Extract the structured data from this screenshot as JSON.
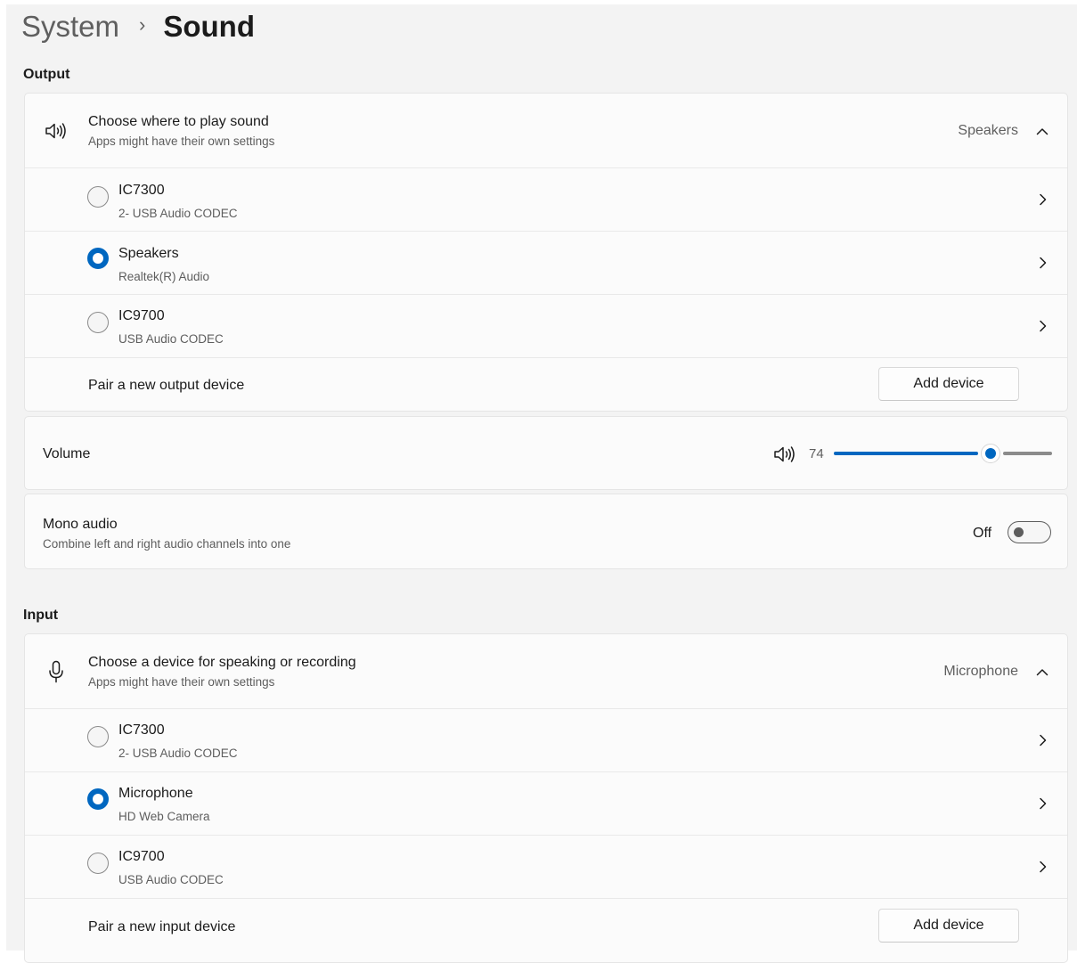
{
  "breadcrumb": {
    "parent": "System",
    "separator": "›",
    "current": "Sound"
  },
  "output": {
    "section_title": "Output",
    "chooser": {
      "title": "Choose where to play sound",
      "subtitle": "Apps might have their own settings",
      "selected_value": "Speakers"
    },
    "devices": [
      {
        "name": "IC7300",
        "detail": "2- USB Audio CODEC",
        "selected": false
      },
      {
        "name": "Speakers",
        "detail": "Realtek(R) Audio",
        "selected": true
      },
      {
        "name": "IC9700",
        "detail": "USB Audio CODEC",
        "selected": false
      }
    ],
    "pair": {
      "label": "Pair a new output device",
      "button": "Add device"
    },
    "volume": {
      "label": "Volume",
      "value": 74,
      "value_text": "74"
    },
    "mono": {
      "title": "Mono audio",
      "subtitle": "Combine left and right audio channels into one",
      "state_text": "Off",
      "enabled": false
    }
  },
  "input": {
    "section_title": "Input",
    "chooser": {
      "title": "Choose a device for speaking or recording",
      "subtitle": "Apps might have their own settings",
      "selected_value": "Microphone"
    },
    "devices": [
      {
        "name": "IC7300",
        "detail": "2- USB Audio CODEC",
        "selected": false
      },
      {
        "name": "Microphone",
        "detail": "HD Web Camera",
        "selected": true
      },
      {
        "name": "IC9700",
        "detail": "USB Audio CODEC",
        "selected": false
      }
    ],
    "pair": {
      "label": "Pair a new input device",
      "button": "Add device"
    }
  },
  "icons": {
    "speaker": "speaker-icon",
    "microphone": "microphone-icon",
    "chevron_up": "chevron-up-icon",
    "chevron_right": "chevron-right-icon"
  },
  "colors": {
    "accent": "#0067c0",
    "background": "#f3f3f3",
    "card": "#fbfbfb"
  }
}
